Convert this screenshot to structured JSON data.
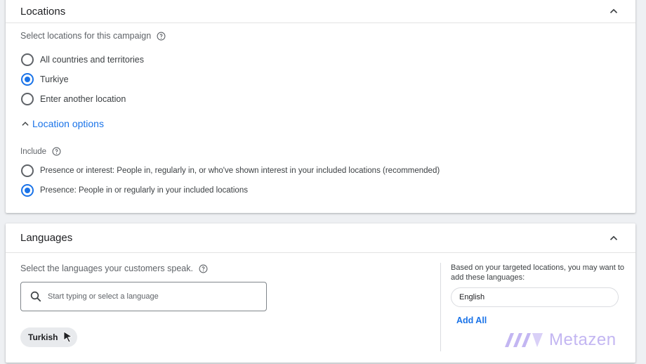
{
  "locations": {
    "title": "Locations",
    "prompt": "Select locations for this campaign",
    "options": [
      {
        "label": "All countries and territories",
        "selected": false
      },
      {
        "label": "Turkiye",
        "selected": true
      },
      {
        "label": "Enter another location",
        "selected": false
      }
    ],
    "options_toggle": "Location options",
    "include_label": "Include",
    "include_options": [
      {
        "label": "Presence or interest: People in, regularly in, or who've shown interest in your included locations (recommended)",
        "selected": false
      },
      {
        "label": "Presence: People in or regularly in your included locations",
        "selected": true
      }
    ]
  },
  "languages": {
    "title": "Languages",
    "prompt": "Select the languages your customers speak.",
    "search_placeholder": "Start typing or select a language",
    "selected_chip": "Turkish",
    "suggestion_note": "Based on your targeted locations, you may want to add these languages:",
    "suggested": "English",
    "add_all": "Add All"
  },
  "watermark": {
    "text": "Metazen"
  },
  "colors": {
    "accent": "#1a73e8",
    "watermark": "#c3b6f2"
  }
}
